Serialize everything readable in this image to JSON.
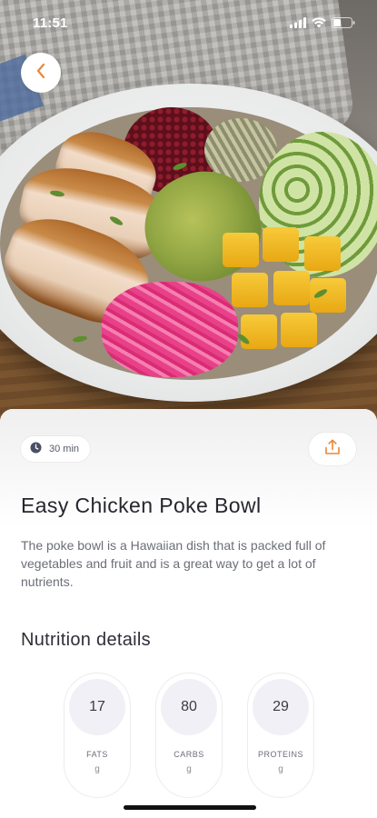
{
  "status_bar": {
    "time": "11:51"
  },
  "recipe": {
    "cook_time": "30 min",
    "title": "Easy Chicken Poke Bowl",
    "description": "The poke bowl is a Hawaiian dish that is packed full of vegetables and fruit and is a great way to get a lot of nutrients."
  },
  "nutrition": {
    "section_title": "Nutrition details",
    "items": [
      {
        "value": "17",
        "label": "FATS",
        "unit": "g"
      },
      {
        "value": "80",
        "label": "CARBS",
        "unit": "g"
      },
      {
        "value": "29",
        "label": "PROTEINS",
        "unit": "g"
      }
    ]
  },
  "colors": {
    "accent": "#e8893a",
    "text_dark": "#26262e",
    "text_muted": "#6b6e78"
  },
  "icons": {
    "back": "chevron-left-icon",
    "share": "share-icon",
    "time": "clock-icon"
  }
}
